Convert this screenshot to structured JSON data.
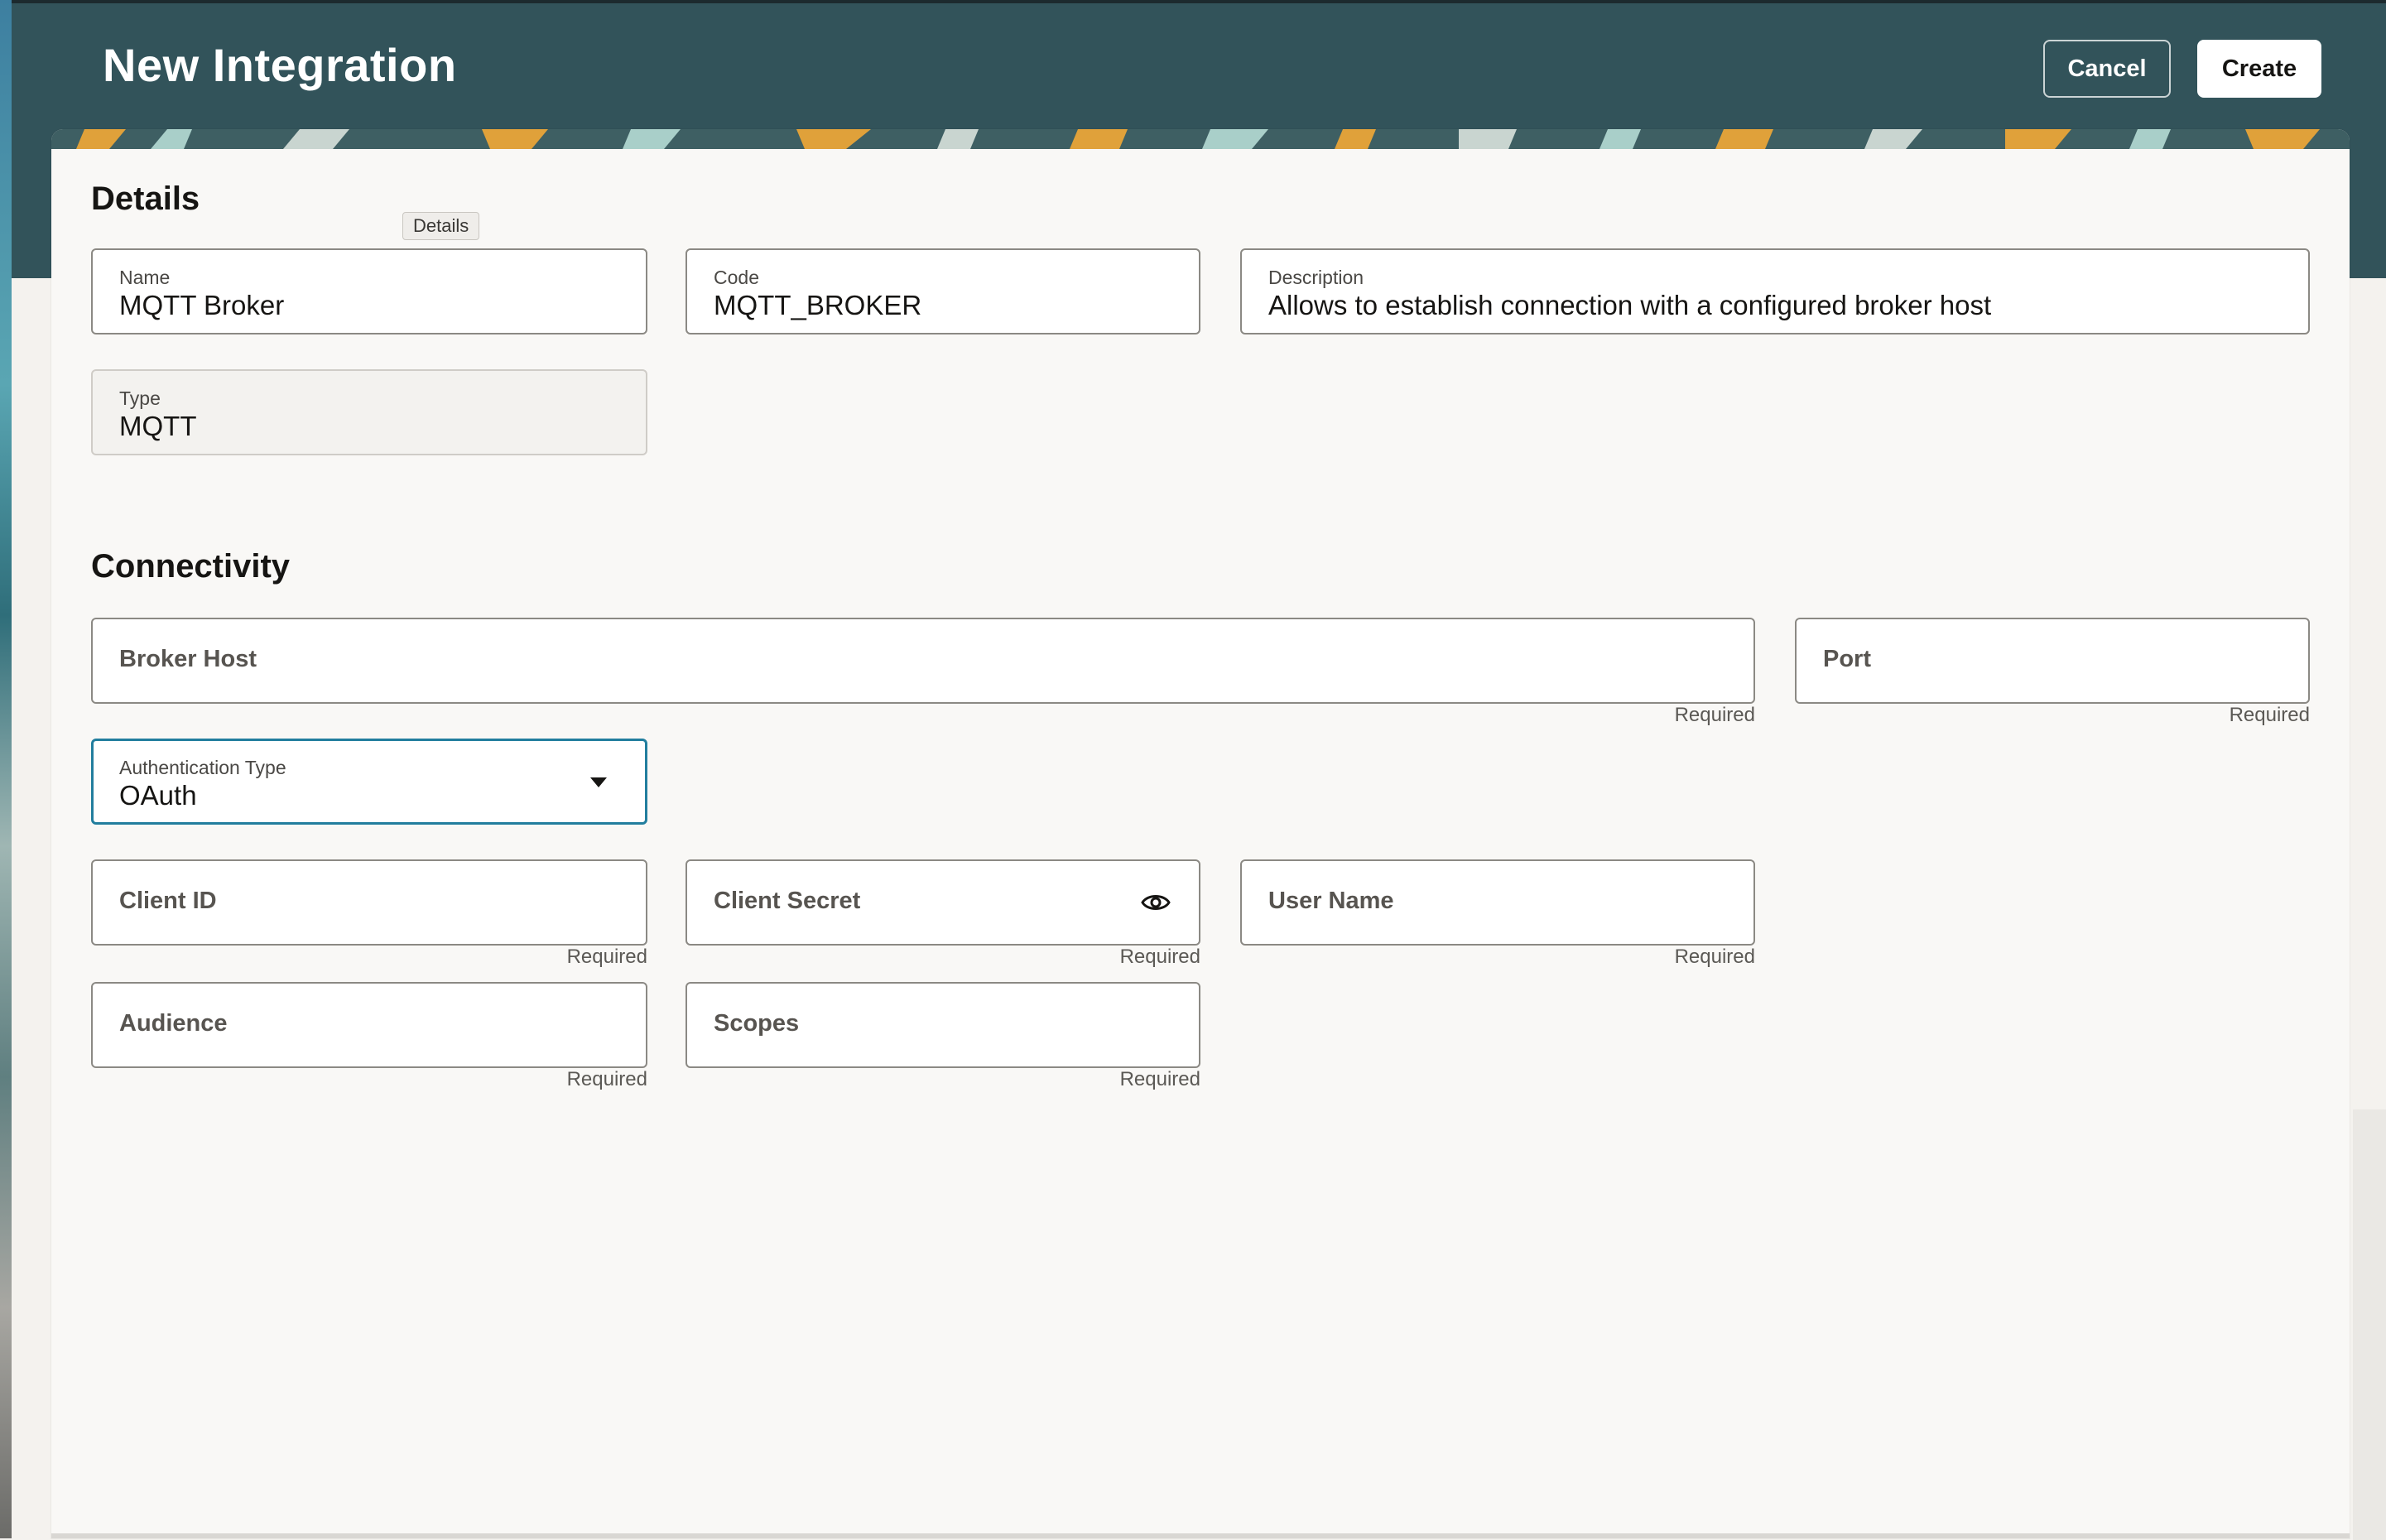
{
  "header": {
    "title": "New Integration",
    "cancel_label": "Cancel",
    "create_label": "Create"
  },
  "details": {
    "title": "Details",
    "tooltip": "Details",
    "name": {
      "label": "Name",
      "value": "MQTT Broker"
    },
    "code": {
      "label": "Code",
      "value": "MQTT_BROKER"
    },
    "description": {
      "label": "Description",
      "value": "Allows to establish connection with a configured broker host"
    },
    "type": {
      "label": "Type",
      "value": "MQTT"
    }
  },
  "connectivity": {
    "title": "Connectivity",
    "broker_host": {
      "label": "Broker Host",
      "hint": "Required"
    },
    "port": {
      "label": "Port",
      "hint": "Required"
    },
    "auth_type": {
      "label": "Authentication Type",
      "value": "OAuth"
    },
    "client_id": {
      "label": "Client ID",
      "hint": "Required"
    },
    "client_secret": {
      "label": "Client Secret",
      "hint": "Required",
      "icon": "eye-icon"
    },
    "user_name": {
      "label": "User Name",
      "hint": "Required"
    },
    "audience": {
      "label": "Audience",
      "hint": "Required"
    },
    "scopes": {
      "label": "Scopes",
      "hint": "Required"
    }
  },
  "colors": {
    "header_bg": "#32535a",
    "panel_bg": "#f9f8f6",
    "focus_border": "#227e9e",
    "pattern_orange": "#e0a13a",
    "pattern_mint": "#a9cfc9"
  }
}
